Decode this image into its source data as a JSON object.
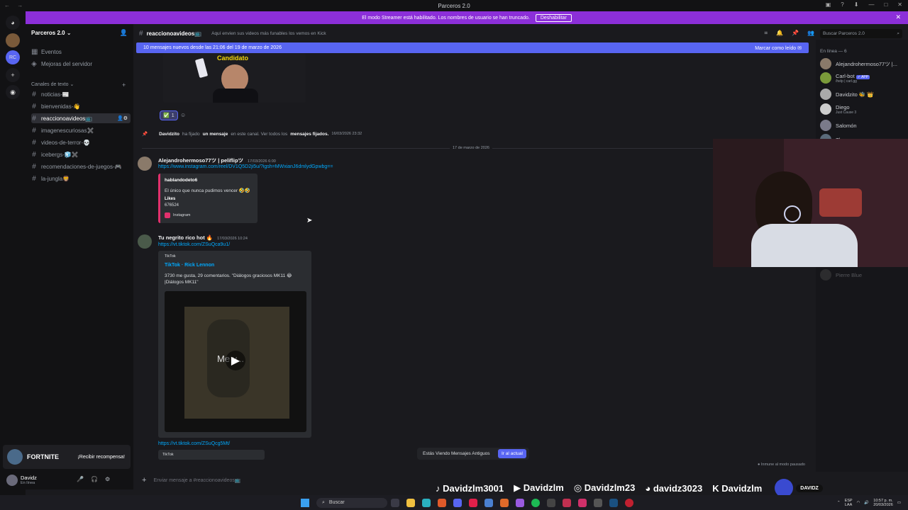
{
  "window": {
    "title": "Parceros 2.0"
  },
  "streamer_banner": {
    "text": "El modo Streamer está habilitado. Los nombres de usuario se han truncado.",
    "button": "Deshabilitar"
  },
  "server": {
    "name": "Parceros 2.0",
    "events": "Eventos",
    "boosts": "Mejoras del servidor",
    "category": "Canales de texto",
    "channels": [
      {
        "name": "noticias-📰"
      },
      {
        "name": "bienvenidas-👋"
      },
      {
        "name": "reaccionoavideos📺"
      },
      {
        "name": "imagenescuriosas✖️"
      },
      {
        "name": "videos-de-terror-💀"
      },
      {
        "name": "icebergs-🧊✖️"
      },
      {
        "name": "recomendaciones-de-juegos-🎮"
      },
      {
        "name": "la-jungla🦁"
      }
    ]
  },
  "promo": {
    "title": "FORTNITE",
    "button": "¡Recibir recompensa!"
  },
  "user_panel": {
    "name": "Davidz",
    "status": "En línea"
  },
  "channel_header": {
    "name": "reaccionoavideos📺",
    "topic": "Aquí envien sus videos más funables los vemos en Kick",
    "search_placeholder": "Buscar Parceros 2.0"
  },
  "new_messages_bar": {
    "text": "10 mensajes nuevos desde las 21:06 del 19 de marzo de 2026",
    "action": "Marcar como leído"
  },
  "top_image": {
    "caption": "Candidato"
  },
  "reactions": [
    {
      "emoji": "✅",
      "count": "1"
    }
  ],
  "pin_notice": {
    "user": "Davidzito",
    "text1": "ha fijado",
    "link1": "un mensaje",
    "text2": "en este canal. Ver todos los",
    "link2": "mensajes fijados.",
    "time": "16/03/2026 23:32"
  },
  "date_divider": "17 de marzo de 2026",
  "messages": [
    {
      "author": "Alejandrohermoso77ツ | peliflipツ",
      "time": "17/03/2026 6:00",
      "link": "https://www.instagram.com/reel/DV1Q5D2ji5u/?igsh=MWxianJ6dmlydGpwbg==",
      "embed": {
        "author": "hablandodeto6",
        "desc": "El único que nunca pudimos vencer 🤣🤣",
        "field_name": "Likes",
        "field_value": "676524",
        "provider": "Instagram"
      }
    },
    {
      "author": "Tu negrito rico hot 🔥",
      "time": "17/03/2026 10:24",
      "link": "https://vt.tiktok.com/ZSuQca9u1/",
      "embed": {
        "provider": "TikTok",
        "title": "TikTok · Rick Lennon",
        "desc": "3730 me gusta, 29 comentarios. \"Diálogos graciosos MK11 😂 |Diálogos MK11\"",
        "video_overlay": "Me y..."
      },
      "link2": "https://vt.tiktok.com/ZSuQcg5Mt/",
      "embed2_provider": "TikTok"
    }
  ],
  "old_messages": {
    "text": "Estás Viendo Mensajes Antiguos",
    "button": "Ir al actual"
  },
  "slowmode": "Inmune al modo pausado",
  "composer": {
    "placeholder": "Enviar mensaje a #reaccionoavideos📺"
  },
  "members": {
    "header": "En línea — 6",
    "list": [
      {
        "name": "Alejandrohermoso77ツ |...",
        "sub": ""
      },
      {
        "name": "Carl-bot",
        "badge": "✓ APP",
        "sub": "/help | carl.gg"
      },
      {
        "name": "Davidzito 🐝 👑",
        "sub": ""
      },
      {
        "name": "Diego",
        "sub": "Just Cause 3"
      },
      {
        "name": "Salomón",
        "sub": ""
      },
      {
        "name": "Zbon",
        "sub": ""
      }
    ],
    "faded": "Pierre Blue"
  },
  "socials": [
    {
      "icon": "tiktok-icon",
      "glyph": "♪",
      "handle": "Davidzlm3001"
    },
    {
      "icon": "youtube-icon",
      "glyph": "▶",
      "handle": "Davidzlm"
    },
    {
      "icon": "instagram-icon",
      "glyph": "◎",
      "handle": "Davidzlm23"
    },
    {
      "icon": "discord-icon",
      "glyph": "◕",
      "handle": "davidz3023"
    },
    {
      "icon": "kick-icon",
      "glyph": "K",
      "handle": "Davidzlm"
    }
  ],
  "brand_badge": "DAVIDZ",
  "taskbar": {
    "search": "Buscar",
    "lang1": "ESP",
    "lang2": "LAA",
    "time": "10:57 p. m.",
    "date": "20/03/2026"
  }
}
